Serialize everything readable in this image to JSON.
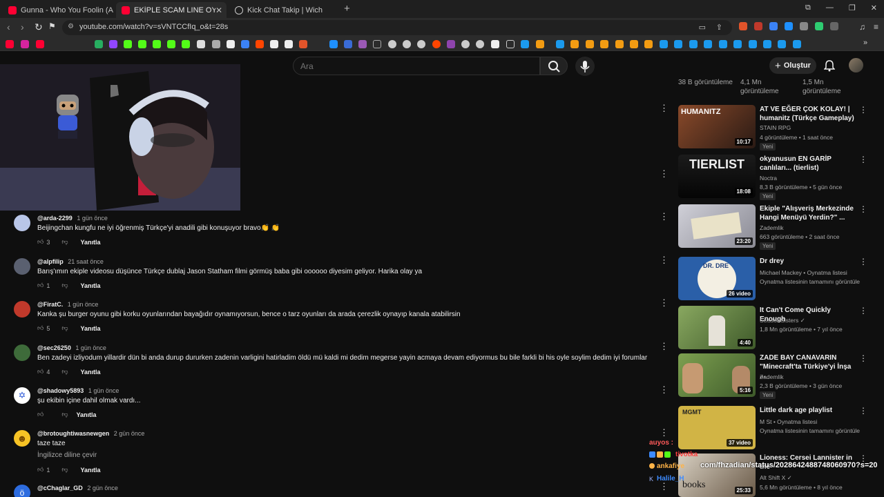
{
  "browser": {
    "tabs": [
      {
        "title": "Gunna - Who You Foolin (Alternative",
        "favicon_color": "#ff0033"
      },
      {
        "title": "EKİPLE SCAM LINE OYNUYORUZ",
        "favicon_color": "#ff0033"
      },
      {
        "title": "Kick Chat Takip | Wich",
        "favicon_color": "#cccccc"
      }
    ],
    "url": "youtube.com/watch?v=sVNTCCfIq_o&t=28s"
  },
  "header": {
    "search_placeholder": "Ara",
    "create_label": "Oluştur"
  },
  "comments": [
    {
      "user": "@arda-2299",
      "time": "1 gün önce",
      "text": "Beijingchan kungfu ne iyi öğrenmiş Türkçe'yi anadili gibi konuşuyor bravo👏 👏",
      "likes": "3",
      "reply": "Yanıtla",
      "avatar_color": "#b9c6e8"
    },
    {
      "user": "@alpfilip",
      "time": "21 saat önce",
      "text": "Barış'ımın ekiple videosu düşünce Türkçe dublaj Jason Statham filmi görmüş baba gibi oooooo diyesim geliyor. Harika olay ya",
      "likes": "1",
      "reply": "Yanıtla",
      "avatar_color": "#5a6070"
    },
    {
      "user": "@FiratC.",
      "time": "1 gün önce",
      "text": "Kanka şu burger oyunu gibi korku oyunlarından bayağıdır oynamıyorsun, bence o tarz oyunları da arada çerezlik oynayıp kanala atabilirsin",
      "likes": "5",
      "reply": "Yanıtla",
      "avatar_color": "#c0392b"
    },
    {
      "user": "@sec26250",
      "time": "1 gün önce",
      "text": "Ben zadeyi izliyodum yillardir dün bi anda durup dururken zadenin varligini hatirladim öldü mü kaldi mi dedim megerse yayin acmaya devam ediyormus bu bile farkli bi his oyle soylim dedim iyi forumlar",
      "likes": "4",
      "reply": "Yanıtla",
      "avatar_color": "#3e6b3a"
    },
    {
      "user": "@shadowy5893",
      "time": "1 gün önce",
      "text": "şu ekibin içine dahil olmak vardı...",
      "likes": "",
      "reply": "Yanıtla",
      "avatar_color": "#ffffff"
    },
    {
      "user": "@brotoughtiwasnewgen",
      "time": "2 gün önce",
      "text": "taze taze",
      "translate": "İngilizce diline çevir",
      "likes": "1",
      "reply": "Yanıtla",
      "avatar_color": "#f7c325"
    },
    {
      "user": "@cChaglar_GD",
      "time": "2 gün önce",
      "text": "",
      "likes": "",
      "reply": "Yanıtla",
      "avatar_color": "#2d6cdf"
    }
  ],
  "top_views": [
    "38 B görüntüleme",
    "4,1 Mn görüntüleme",
    "1,5 Mn görüntüleme"
  ],
  "recommendations": [
    {
      "title": "AT VE EĞER ÇOK KOLAY! | humanitz (Türkçe Gameplay)",
      "channel": "STAIN RPG",
      "meta": "4 görüntüleme • 1 saat önce",
      "badge": "Yeni",
      "duration": "10:17",
      "thumb_color": "#6b3d2a",
      "thumb_text": "HUMANITZ"
    },
    {
      "title": "okyanusun EN GARİP canlıları... (tierlist)",
      "channel": "Noctra",
      "meta": "8,3 B görüntüleme • 5 gün önce",
      "badge": "Yeni",
      "duration": "18:08",
      "thumb_color": "#111111",
      "thumb_text": "TIERLIST"
    },
    {
      "title": "Ekiple \"Alışveriş Merkezinde Hangi Menüyü Yerdin?\" ...",
      "channel": "Zademlik",
      "meta": "663 görüntüleme • 2 saat önce",
      "badge": "Yeni",
      "duration": "23:20",
      "thumb_color": "#b9b9c2",
      "thumb_text": ""
    },
    {
      "title": "Dr drey",
      "channel": "Michael Mackey • Oynatma listesi",
      "meta": "Oynatma listesinin tamamını görüntüle",
      "badge": "",
      "duration": "26 video",
      "thumb_color": "#2a5fa8",
      "thumb_text": "DR. DRE"
    },
    {
      "title": "It Can't Come Quickly Enough",
      "channel": "Scissor Sisters ✓",
      "meta": "1,8 Mn görüntüleme • 7 yıl önce",
      "badge": "",
      "duration": "4:40",
      "thumb_color": "#6a8a4a",
      "thumb_text": ""
    },
    {
      "title": "ZADE BAY CANAVARIN \"Minecraft'ta Türkiye'yi İnşa ...",
      "channel": "Zademlik",
      "meta": "2,3 B görüntüleme • 3 gün önce",
      "badge": "Yeni",
      "duration": "5:16",
      "thumb_color": "#5c7a3a",
      "thumb_text": ""
    },
    {
      "title": "Little dark age playlist",
      "channel": "M St • Oynatma listesi",
      "meta": "Oynatma listesinin tamamını görüntüle",
      "badge": "",
      "duration": "37 video",
      "thumb_color": "#c8a93a",
      "thumb_text": "MGMT"
    },
    {
      "title": "Lioness: Cersei Lannister in the",
      "channel": "Alt Shift X ✓",
      "meta": "5,6 Mn görüntüleme • 8 yıl önce",
      "badge": "",
      "duration": "25:33",
      "thumb_color": "#cfc6b8",
      "thumb_text": "books"
    }
  ],
  "chat": [
    {
      "user": "auyos :",
      "color": "#ff5a5a"
    },
    {
      "user": "tivotka",
      "color": "#ff4040"
    },
    {
      "user": "ankafiye",
      "color": "#ffb347"
    },
    {
      "user": "Halile_H",
      "color": "#3d8bff"
    }
  ],
  "chat_overlay_text": "com/fhzadian/status/2028642488748060970?s=20"
}
